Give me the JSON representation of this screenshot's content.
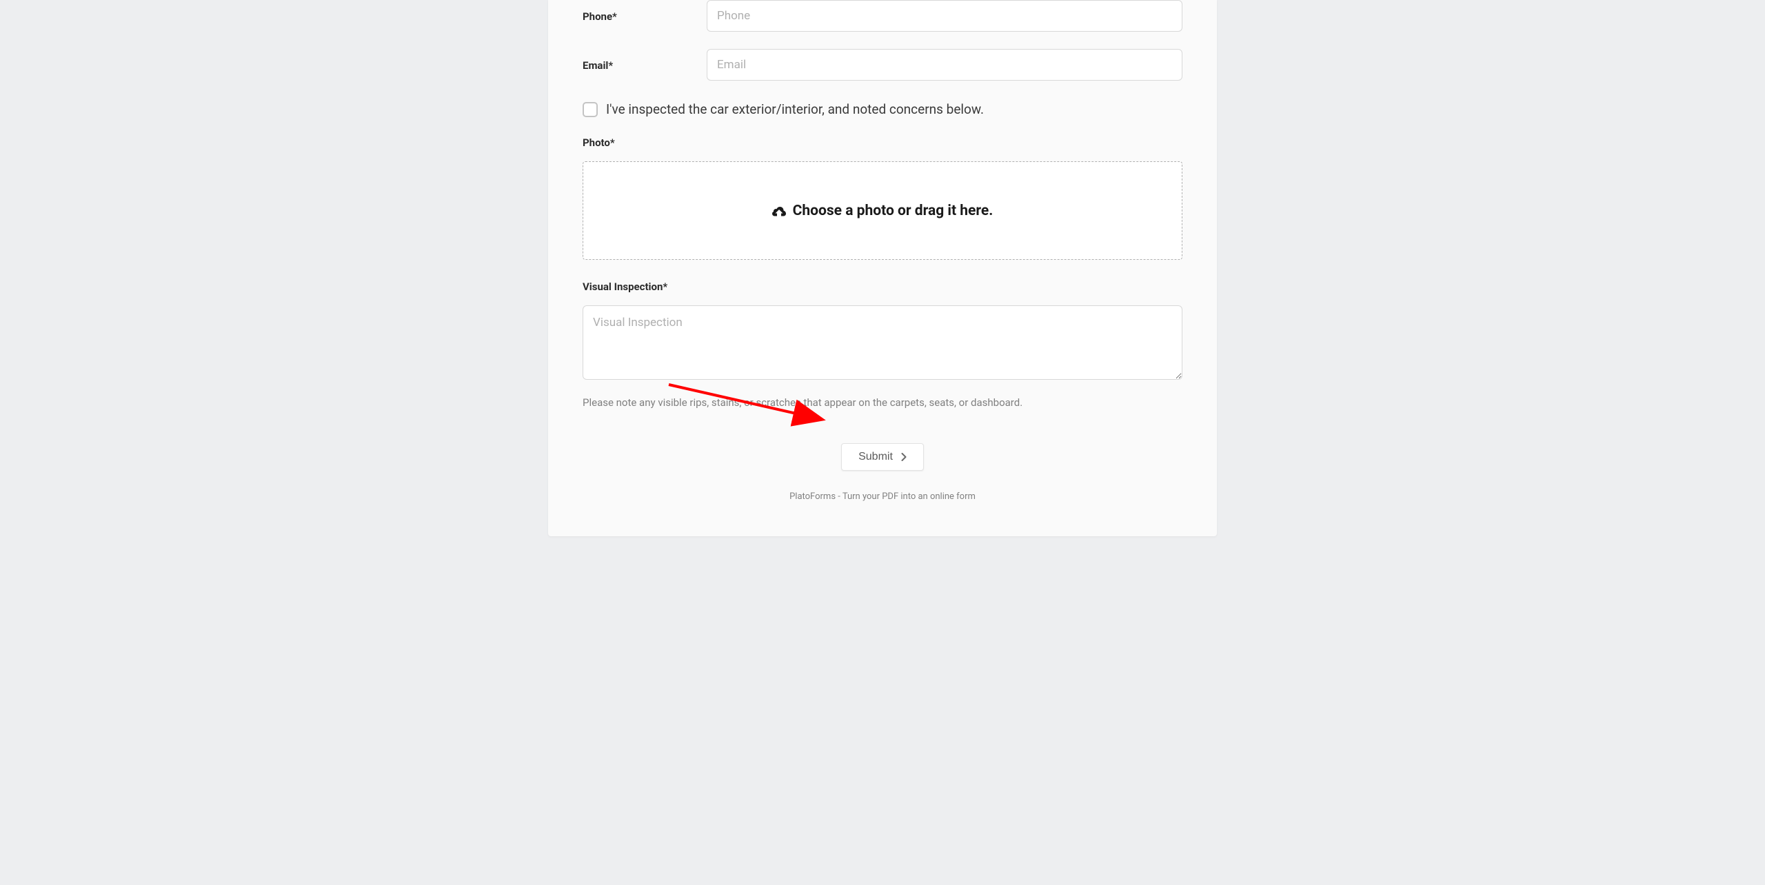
{
  "phone": {
    "label": "Phone*",
    "placeholder": "Phone"
  },
  "email": {
    "label": "Email*",
    "placeholder": "Email"
  },
  "inspected_checkbox": {
    "label": "I've inspected the car exterior/interior, and noted concerns below."
  },
  "photo": {
    "label": "Photo*",
    "upload_text": "Choose a photo or drag it here."
  },
  "visual_inspection": {
    "label": "Visual Inspection*",
    "placeholder": "Visual Inspection",
    "helper": "Please note any visible rips, stains, or scratches that appear on the carpets, seats, or dashboard."
  },
  "submit": {
    "label": "Submit"
  },
  "footer": {
    "text": "PlatoForms - Turn your PDF into an online form"
  }
}
